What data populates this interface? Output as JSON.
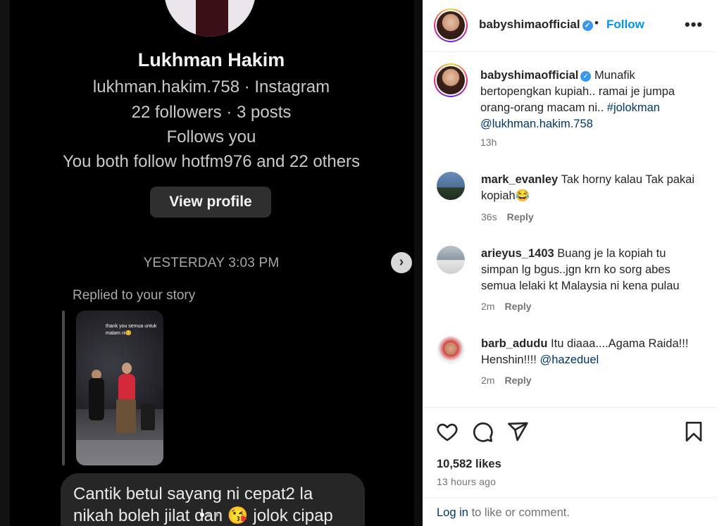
{
  "media": {
    "profile_name": "Lukhman Hakim",
    "profile_handle_line": "lukhman.hakim.758 · Instagram",
    "followers_line": "22 followers · 3 posts",
    "follows_you": "Follows you",
    "mutual_line": "You both follow hotfm976 and 22 others",
    "view_profile_label": "View profile",
    "timestamp": "YESTERDAY 3:03 PM",
    "replied_label": "Replied to your story",
    "story_caption": "thank you semua untuk malam ni😊",
    "message_text": "Cantik betul sayang ni cepat2 la nikah boleh jilat dan 😘 jolok cipap",
    "next_icon": "chevron-right-icon",
    "carousel_dots": 3,
    "carousel_active_dot": 1
  },
  "post": {
    "username": "babyshimaofficial",
    "verified_icon": "verified-badge-icon",
    "dot": "•",
    "follow_label": "Follow",
    "more_icon": "more-horizontal-icon",
    "caption": {
      "username": "babyshimaofficial",
      "text": "Munafik bertopengkan kupiah.. ramai je jumpa orang-orang macam ni..",
      "hashtag": "#jolokman",
      "mention": "@lukhman.hakim.758",
      "time": "13h"
    },
    "comments": [
      {
        "username": "mark_evanley",
        "text": "Tak horny kalau Tak pakai kopiah😂",
        "time": "36s",
        "reply_label": "Reply"
      },
      {
        "username": "arieyus_1403",
        "text": "Buang je la kopiah tu simpan lg bgus..jgn krn ko sorg abes semua lelaki kt Malaysia ni kena pulau",
        "time": "2m",
        "reply_label": "Reply"
      },
      {
        "username": "barb_adudu",
        "text": "Itu diaaa....Agama Raida!!! Henshin!!!!",
        "mention": "@hazeduel",
        "time": "2m",
        "reply_label": "Reply"
      }
    ],
    "likes": "10,582 likes",
    "post_time": "13 hours ago",
    "login_link": "Log in",
    "login_rest": "to like or comment."
  },
  "colors": {
    "accent": "#0095f6",
    "link": "#00376b",
    "muted": "#737373",
    "media_bg": "#000000",
    "bubble_bg": "#262626"
  }
}
